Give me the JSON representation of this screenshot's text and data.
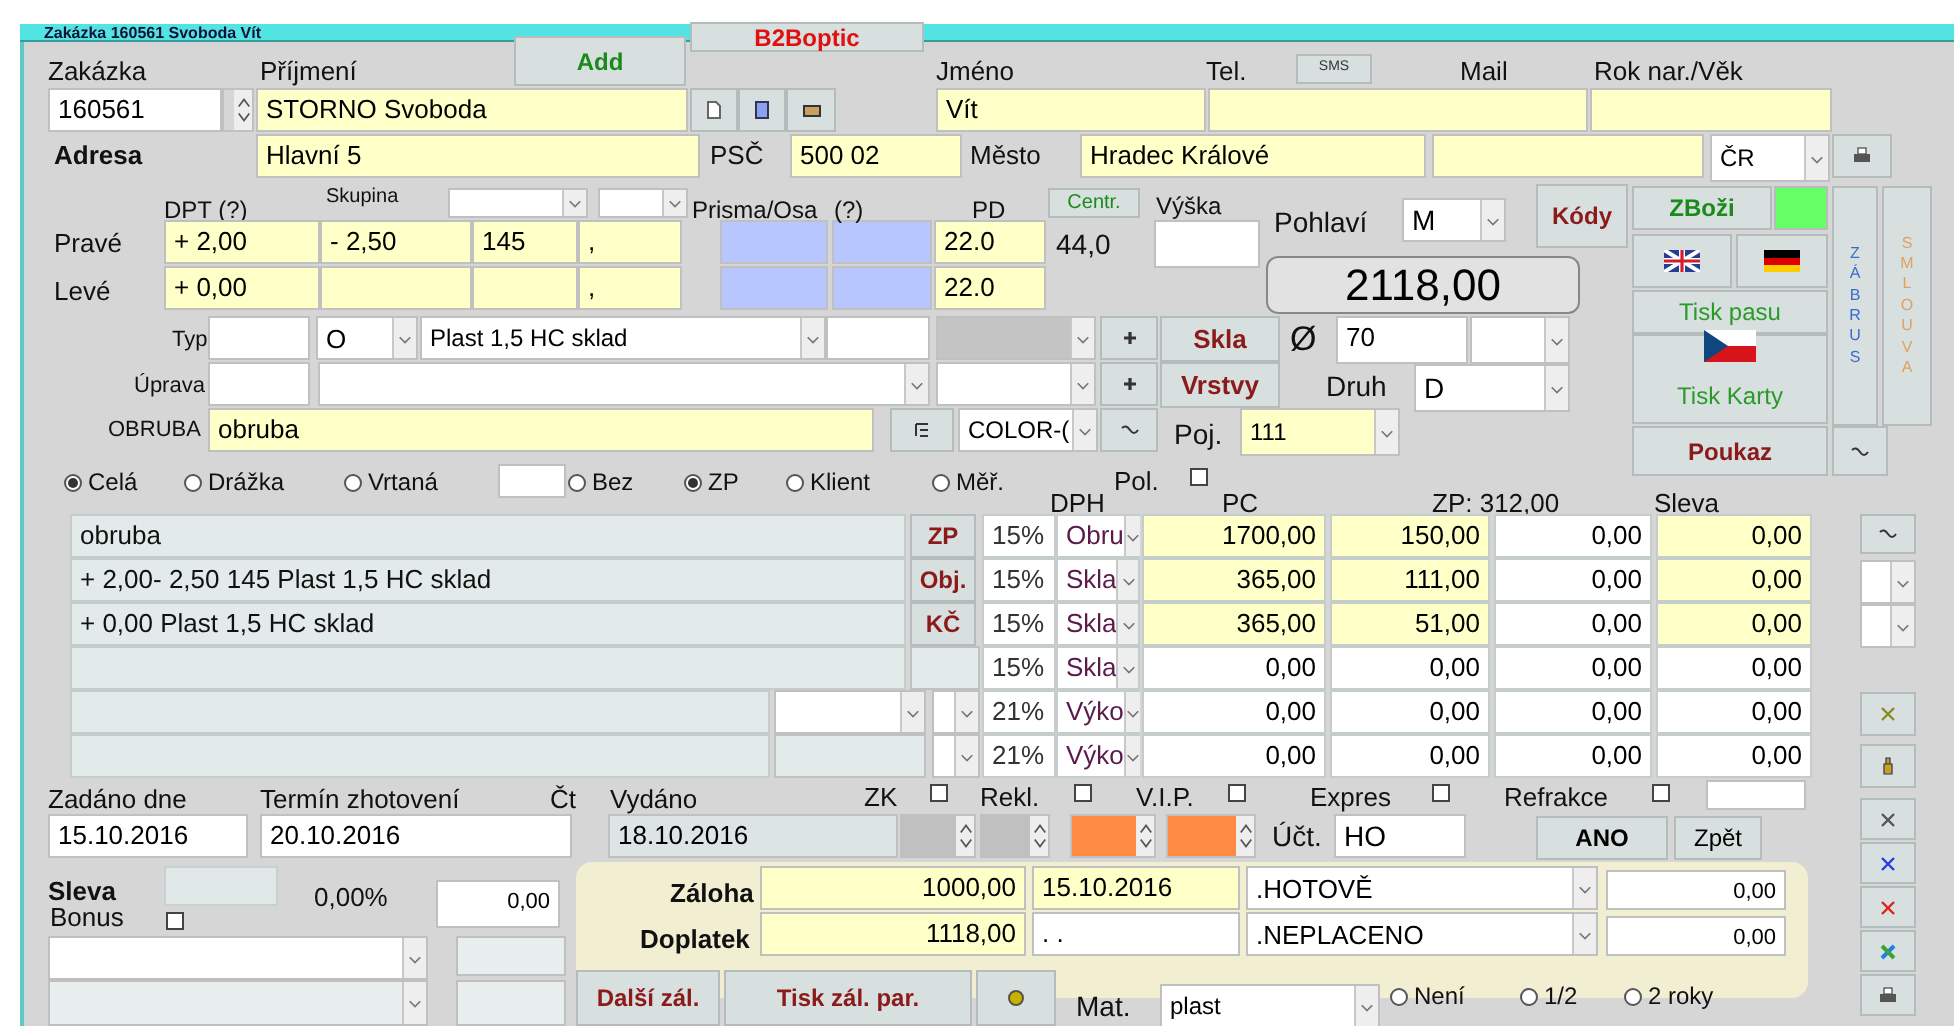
{
  "window": {
    "title": "Zakázka 160561 Svoboda Vít"
  },
  "header": [
    {
      "kind": "button",
      "text": "Add"
    },
    {
      "kind": "button",
      "text": "B2Boptic"
    },
    {
      "kind": "button",
      "text": "SMS"
    }
  ],
  "customer": [
    {
      "kind": "label",
      "text": "Zakázka"
    },
    {
      "kind": "field",
      "value": "160561"
    },
    {
      "kind": "label",
      "text": "Příjmení"
    },
    {
      "kind": "field",
      "value": "STORNO Svoboda"
    },
    {
      "kind": "label",
      "text": "Jméno"
    },
    {
      "kind": "field",
      "value": "Vít"
    },
    {
      "kind": "label",
      "text": "Tel."
    },
    {
      "kind": "label",
      "text": "Mail"
    },
    {
      "kind": "label",
      "text": "Rok nar./Věk"
    },
    {
      "kind": "label",
      "text": "Adresa"
    },
    {
      "kind": "field",
      "value": "Hlavní 5"
    },
    {
      "kind": "label",
      "text": "PSČ"
    },
    {
      "kind": "field",
      "value": "500 02"
    },
    {
      "kind": "label",
      "text": "Město"
    },
    {
      "kind": "field",
      "value": "Hradec Králové"
    },
    {
      "kind": "combo",
      "value": "ČR"
    }
  ],
  "prescription": [
    {
      "kind": "label",
      "text": "DPT (?)"
    },
    {
      "kind": "label",
      "text": "Skupina"
    },
    {
      "kind": "label",
      "text": "Prisma/Osa"
    },
    {
      "kind": "label",
      "text": "(?)"
    },
    {
      "kind": "label",
      "text": "PD"
    },
    {
      "kind": "button",
      "text": "Centr."
    },
    {
      "kind": "label",
      "text": "Výška"
    },
    {
      "kind": "label",
      "text": "Pohlaví"
    },
    {
      "kind": "combo",
      "value": "M"
    },
    {
      "kind": "label",
      "text": "Pravé"
    },
    {
      "kind": "field",
      "value": "+ 2,00"
    },
    {
      "kind": "field",
      "value": "- 2,50"
    },
    {
      "kind": "field",
      "value": "145"
    },
    {
      "kind": "field",
      "value": ","
    },
    {
      "kind": "field",
      "value": "22.0"
    },
    {
      "kind": "label",
      "text": "44,0"
    },
    {
      "kind": "label",
      "text": "Levé"
    },
    {
      "kind": "field",
      "value": "+ 0,00"
    },
    {
      "kind": "field",
      "value": ","
    },
    {
      "kind": "field",
      "value": "22.0"
    },
    {
      "kind": "total",
      "value": "2118,00"
    }
  ],
  "lens": [
    {
      "kind": "label",
      "text": "Typ"
    },
    {
      "kind": "combo",
      "value": "O"
    },
    {
      "kind": "combo",
      "value": "Plast 1,5 HC sklad"
    },
    {
      "kind": "button",
      "text": "Skla"
    },
    {
      "kind": "label",
      "text": "Ø"
    },
    {
      "kind": "field",
      "value": "70"
    },
    {
      "kind": "label",
      "text": "Úprava"
    },
    {
      "kind": "button",
      "text": "Vrstvy"
    },
    {
      "kind": "label",
      "text": "Druh"
    },
    {
      "kind": "combo",
      "value": "D"
    },
    {
      "kind": "label",
      "text": "OBRUBA"
    },
    {
      "kind": "field",
      "value": "obruba"
    },
    {
      "kind": "combo",
      "value": "COLOR-("
    },
    {
      "kind": "label",
      "text": "Poj."
    },
    {
      "kind": "combo",
      "value": "111"
    }
  ],
  "right_panel": [
    {
      "kind": "button",
      "text": "Kódy"
    },
    {
      "kind": "button",
      "text": "ZBoži"
    },
    {
      "kind": "button",
      "text": "Tisk pasu"
    },
    {
      "kind": "flag_button",
      "text": "Tisk Karty"
    },
    {
      "kind": "button",
      "text": "Poukaz"
    },
    {
      "kind": "vertical_button",
      "text": "ZÁBRUS"
    },
    {
      "kind": "vertical_button",
      "text": "SMLOUVA"
    }
  ],
  "options": [
    {
      "kind": "radio",
      "text": "Celá",
      "selected": true
    },
    {
      "kind": "radio",
      "text": "Drážka",
      "selected": false
    },
    {
      "kind": "radio",
      "text": "Vrtaná",
      "selected": false
    },
    {
      "kind": "radio",
      "text": "Bez",
      "selected": false
    },
    {
      "kind": "radio",
      "text": "ZP",
      "selected": true
    },
    {
      "kind": "radio",
      "text": "Klient",
      "selected": false
    },
    {
      "kind": "radio",
      "text": "Měř.",
      "selected": false
    },
    {
      "kind": "check",
      "text": "Pol.",
      "checked": false
    }
  ],
  "items": {
    "columns": [
      "DPH",
      "PC",
      "ZP: 312,00",
      "Sleva"
    ],
    "rows": [
      {
        "description": "obruba",
        "action": "ZP",
        "vat": "15%",
        "type": "Obru",
        "pc": "1700,00",
        "zp": "150,00",
        "column_5": "0,00",
        "discount": "0,00"
      },
      {
        "description": "+ 2,00- 2,50 145 Plast 1,5 HC sklad",
        "action": "Obj.",
        "vat": "15%",
        "type": "Skla",
        "pc": "365,00",
        "zp": "111,00",
        "column_5": "0,00",
        "discount": "0,00"
      },
      {
        "description": "+ 0,00 Plast 1,5 HC sklad",
        "action": "KČ",
        "vat": "15%",
        "type": "Skla",
        "pc": "365,00",
        "zp": "51,00",
        "column_5": "0,00",
        "discount": "0,00"
      },
      {
        "vat": "15%",
        "type": "Skla",
        "pc": "0,00",
        "zp": "0,00",
        "column_5": "0,00",
        "discount": "0,00"
      },
      {
        "vat": "21%",
        "type": "Výko",
        "pc": "0,00",
        "zp": "0,00",
        "column_5": "0,00",
        "discount": "0,00"
      },
      {
        "vat": "21%",
        "type": "Výko",
        "pc": "0,00",
        "zp": "0,00",
        "column_5": "0,00",
        "discount": "0,00"
      }
    ]
  },
  "dates": [
    {
      "kind": "label",
      "text": "Zadáno dne"
    },
    {
      "kind": "label",
      "text": "Termín zhotovení"
    },
    {
      "kind": "label",
      "text": "Čt"
    },
    {
      "kind": "label",
      "text": "Vydáno"
    },
    {
      "kind": "check",
      "text": "ZK",
      "checked": false
    },
    {
      "kind": "check",
      "text": "Rekl.",
      "checked": false
    },
    {
      "kind": "check",
      "text": "V.I.P.",
      "checked": false
    },
    {
      "kind": "check",
      "text": "Expres",
      "checked": false
    },
    {
      "kind": "check",
      "text": "Refrakce",
      "checked": false
    },
    {
      "kind": "field",
      "value": "15.10.2016"
    },
    {
      "kind": "field",
      "value": "20.10.2016"
    },
    {
      "kind": "field",
      "value": "18.10.2016"
    },
    {
      "kind": "label",
      "text": "Účt."
    },
    {
      "kind": "field",
      "value": "HO"
    },
    {
      "kind": "button",
      "text": "ANO"
    },
    {
      "kind": "button",
      "text": "Zpět"
    }
  ],
  "discount": [
    {
      "kind": "label",
      "text": "Sleva"
    },
    {
      "kind": "label",
      "text": "0,00%"
    },
    {
      "kind": "field",
      "value": "0,00"
    },
    {
      "kind": "check",
      "text": "Bonus",
      "checked": false
    }
  ],
  "payment": [
    {
      "kind": "label",
      "text": "Záloha"
    },
    {
      "kind": "field",
      "value": "1000,00"
    },
    {
      "kind": "field",
      "value": "15.10.2016"
    },
    {
      "kind": "combo",
      "value": ".HOTOVĚ"
    },
    {
      "kind": "field",
      "value": "0,00"
    },
    {
      "kind": "label",
      "text": "Doplatek"
    },
    {
      "kind": "field",
      "value": "1118,00"
    },
    {
      "kind": "field",
      "value": ". ."
    },
    {
      "kind": "combo",
      "value": ".NEPLACENO"
    },
    {
      "kind": "field",
      "value": "0,00"
    },
    {
      "kind": "button",
      "text": "Další zál."
    },
    {
      "kind": "button",
      "text": "Tisk zál. par."
    },
    {
      "kind": "label",
      "text": "Mat."
    },
    {
      "kind": "combo",
      "value": "plast"
    },
    {
      "kind": "radio",
      "text": "Není",
      "selected": false
    },
    {
      "kind": "radio",
      "text": "1/2",
      "selected": false
    },
    {
      "kind": "radio",
      "text": "2 roky",
      "selected": false
    }
  ]
}
